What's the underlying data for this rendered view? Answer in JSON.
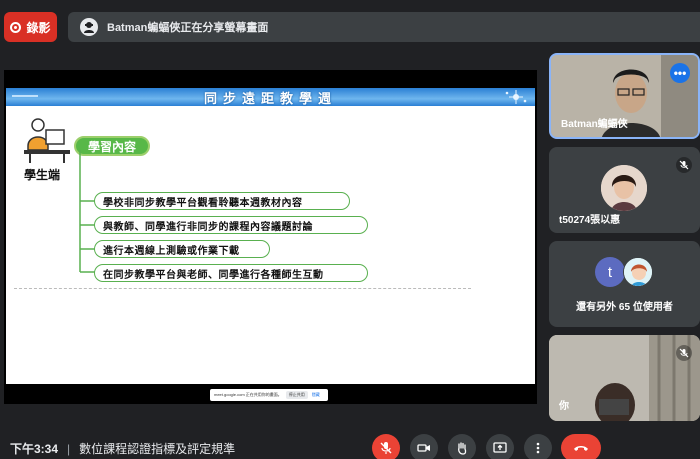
{
  "top_bar": {
    "record_label": "錄影",
    "share_message": "Batman蝙蝠俠正在分享螢幕畫面"
  },
  "slide": {
    "title": "同步遠距教學週",
    "content_pill": "學習內容",
    "role_label": "學生端",
    "items": [
      "學校非同步教學平台觀看聆聽本週教材內容",
      "與教師、同學進行非同步的課程內容議題討論",
      "進行本週線上測驗或作業下載",
      "在同步教學平台與老師、同學進行各種師生互動"
    ]
  },
  "share_toast": {
    "message": "meet.google.com 正在共用你的畫面。",
    "stop_label": "停止共用",
    "hide_label": "隱藏"
  },
  "participants": {
    "tile1_name": "Batman蝙蝠俠",
    "tile2_name": "t50274張以惠",
    "tile3_avatar_letter": "t",
    "tile3_label": "還有另外 65 位使用者",
    "tile4_name": "你"
  },
  "bottom_bar": {
    "time": "下午3:34",
    "separator": "|",
    "meeting_title": "數位課程認證指標及評定規準"
  },
  "colors": {
    "record_red": "#d93025",
    "control_red": "#ea4335",
    "accent_blue": "#1a73e8",
    "bar_dark": "#3c4043",
    "background": "#202124",
    "slide_green": "#58b848"
  },
  "icons": [
    "record-icon",
    "presenter-icon",
    "more-options-icon",
    "mic-off-icon",
    "camera-icon",
    "raise-hand-icon",
    "present-screen-icon",
    "more-vert-icon",
    "end-call-icon"
  ]
}
